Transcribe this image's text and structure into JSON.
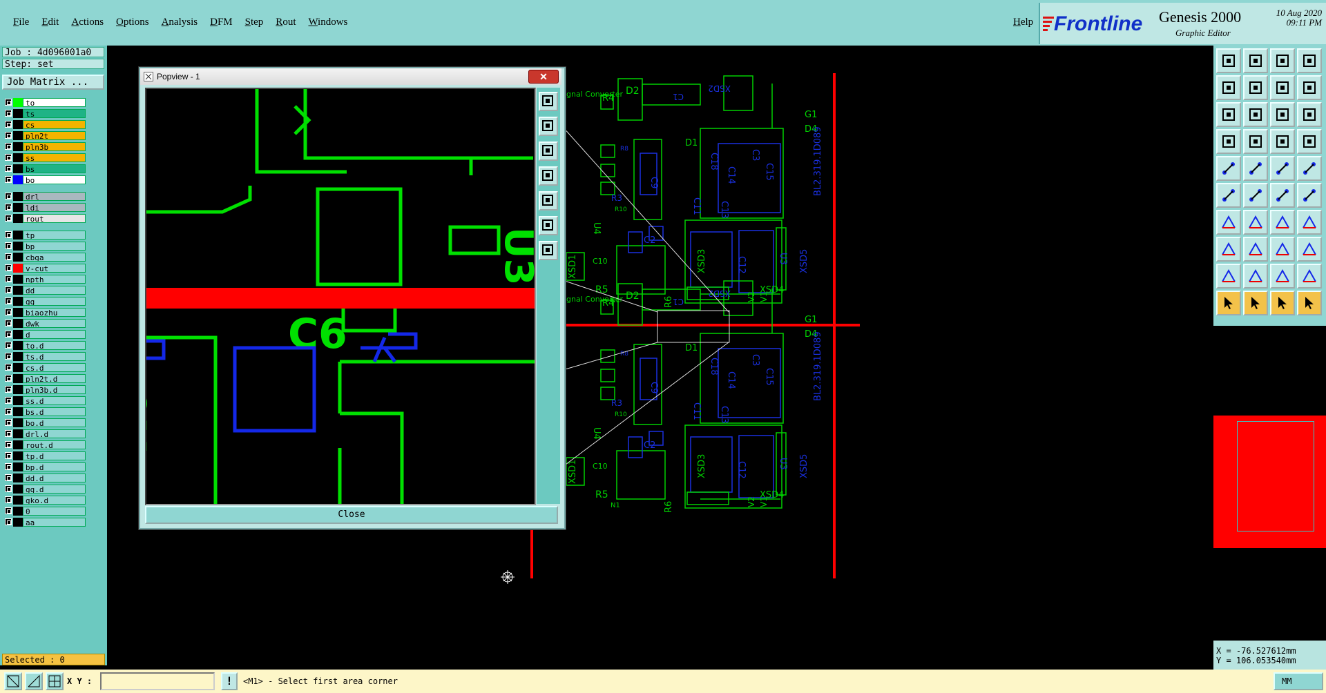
{
  "menubar": {
    "items": [
      "File",
      "Edit",
      "Actions",
      "Options",
      "Analysis",
      "DFM",
      "Step",
      "Rout",
      "Windows"
    ],
    "help": "Help"
  },
  "brand": {
    "logo": "Frontline",
    "product": "Genesis 2000",
    "subtitle": "Graphic Editor",
    "date": "10 Aug 2020",
    "time": "09:11 PM"
  },
  "leftpanel": {
    "job": "Job : 4d096001a0",
    "step": "Step: set",
    "job_matrix": "Job Matrix ...",
    "layers_board": [
      {
        "name": "to",
        "color": "#00ff00",
        "bg": "#ffffff"
      },
      {
        "name": "ts",
        "color": "#000000",
        "bg": "#1fb386"
      },
      {
        "name": "cs",
        "color": "#000000",
        "bg": "#f3b400"
      },
      {
        "name": "pln2t",
        "color": "#000000",
        "bg": "#f3b400"
      },
      {
        "name": "pln3b",
        "color": "#000000",
        "bg": "#f3b400"
      },
      {
        "name": "ss",
        "color": "#000000",
        "bg": "#f3b400"
      },
      {
        "name": "bs",
        "color": "#000000",
        "bg": "#1fb386"
      },
      {
        "name": "bo",
        "color": "#0000ff",
        "bg": "#ffffff"
      }
    ],
    "layers_drill": [
      {
        "name": "drl",
        "color": "#000000",
        "bg": "#a9b8bf"
      },
      {
        "name": "ldi",
        "color": "#000000",
        "bg": "#a9b8bf"
      },
      {
        "name": "rout",
        "color": "#000000",
        "bg": "#e6e6e6"
      }
    ],
    "layers_misc": [
      {
        "name": "tp",
        "color": "#000000",
        "bg": "#8fd6d2"
      },
      {
        "name": "bp",
        "color": "#000000",
        "bg": "#8fd6d2"
      },
      {
        "name": "cbga",
        "color": "#000000",
        "bg": "#8fd6d2"
      },
      {
        "name": "v-cut",
        "color": "#ff0000",
        "bg": "#8fd6d2"
      },
      {
        "name": "npth",
        "color": "#000000",
        "bg": "#8fd6d2"
      },
      {
        "name": "dd",
        "color": "#000000",
        "bg": "#8fd6d2"
      },
      {
        "name": "gg",
        "color": "#000000",
        "bg": "#8fd6d2"
      },
      {
        "name": "biaozhu",
        "color": "#000000",
        "bg": "#8fd6d2"
      },
      {
        "name": "dwk",
        "color": "#000000",
        "bg": "#8fd6d2"
      },
      {
        "name": "d",
        "color": "#000000",
        "bg": "#8fd6d2"
      },
      {
        "name": "to.d",
        "color": "#000000",
        "bg": "#8fd6d2"
      },
      {
        "name": "ts.d",
        "color": "#000000",
        "bg": "#8fd6d2"
      },
      {
        "name": "cs.d",
        "color": "#000000",
        "bg": "#8fd6d2"
      },
      {
        "name": "pln2t.d",
        "color": "#000000",
        "bg": "#8fd6d2"
      },
      {
        "name": "pln3b.d",
        "color": "#000000",
        "bg": "#8fd6d2"
      },
      {
        "name": "ss.d",
        "color": "#000000",
        "bg": "#8fd6d2"
      },
      {
        "name": "bs.d",
        "color": "#000000",
        "bg": "#8fd6d2"
      },
      {
        "name": "bo.d",
        "color": "#000000",
        "bg": "#8fd6d2"
      },
      {
        "name": "drl.d",
        "color": "#000000",
        "bg": "#8fd6d2"
      },
      {
        "name": "rout.d",
        "color": "#000000",
        "bg": "#8fd6d2"
      },
      {
        "name": "tp.d",
        "color": "#000000",
        "bg": "#8fd6d2"
      },
      {
        "name": "bp.d",
        "color": "#000000",
        "bg": "#8fd6d2"
      },
      {
        "name": "dd.d",
        "color": "#000000",
        "bg": "#8fd6d2"
      },
      {
        "name": "gg.d",
        "color": "#000000",
        "bg": "#8fd6d2"
      },
      {
        "name": "gko.d",
        "color": "#000000",
        "bg": "#8fd6d2"
      },
      {
        "name": "0",
        "color": "#000000",
        "bg": "#8fd6d2"
      },
      {
        "name": "aa",
        "color": "#000000",
        "bg": "#8fd6d2"
      }
    ],
    "selected": "Selected : 0"
  },
  "bottombar": {
    "xy_label": "X Y :",
    "xy_value": "",
    "excl": "!",
    "status": "<M1> - Select first area corner",
    "units": "MM"
  },
  "coords": {
    "x": "X = -76.527612mm",
    "y": "Y = 106.053540mm"
  },
  "popview": {
    "title": "Popview - 1",
    "close_label": "Close",
    "close_x": "✕"
  },
  "pcb": {
    "labels": [
      "Signal Converter",
      "D2",
      "R4",
      "C1",
      "XSD2",
      "G1",
      "D1",
      "D4",
      "C18",
      "C9",
      "R3",
      "R10",
      "R8",
      "C3",
      "C14",
      "C15",
      "C13",
      "C2",
      "C10",
      "C12",
      "C11",
      "U4",
      "U3",
      "R5",
      "N1",
      "R6",
      "V1",
      "V2",
      "XSD1",
      "XSD3",
      "XSD4",
      "XSD5",
      "BL2.319.1D089"
    ],
    "zoom_labels": [
      "R6",
      "C6",
      "U3"
    ]
  },
  "colors": {
    "green": "#00e000",
    "blue": "#1428e8",
    "red": "#ff0000",
    "teal": "#8fd6d2"
  }
}
